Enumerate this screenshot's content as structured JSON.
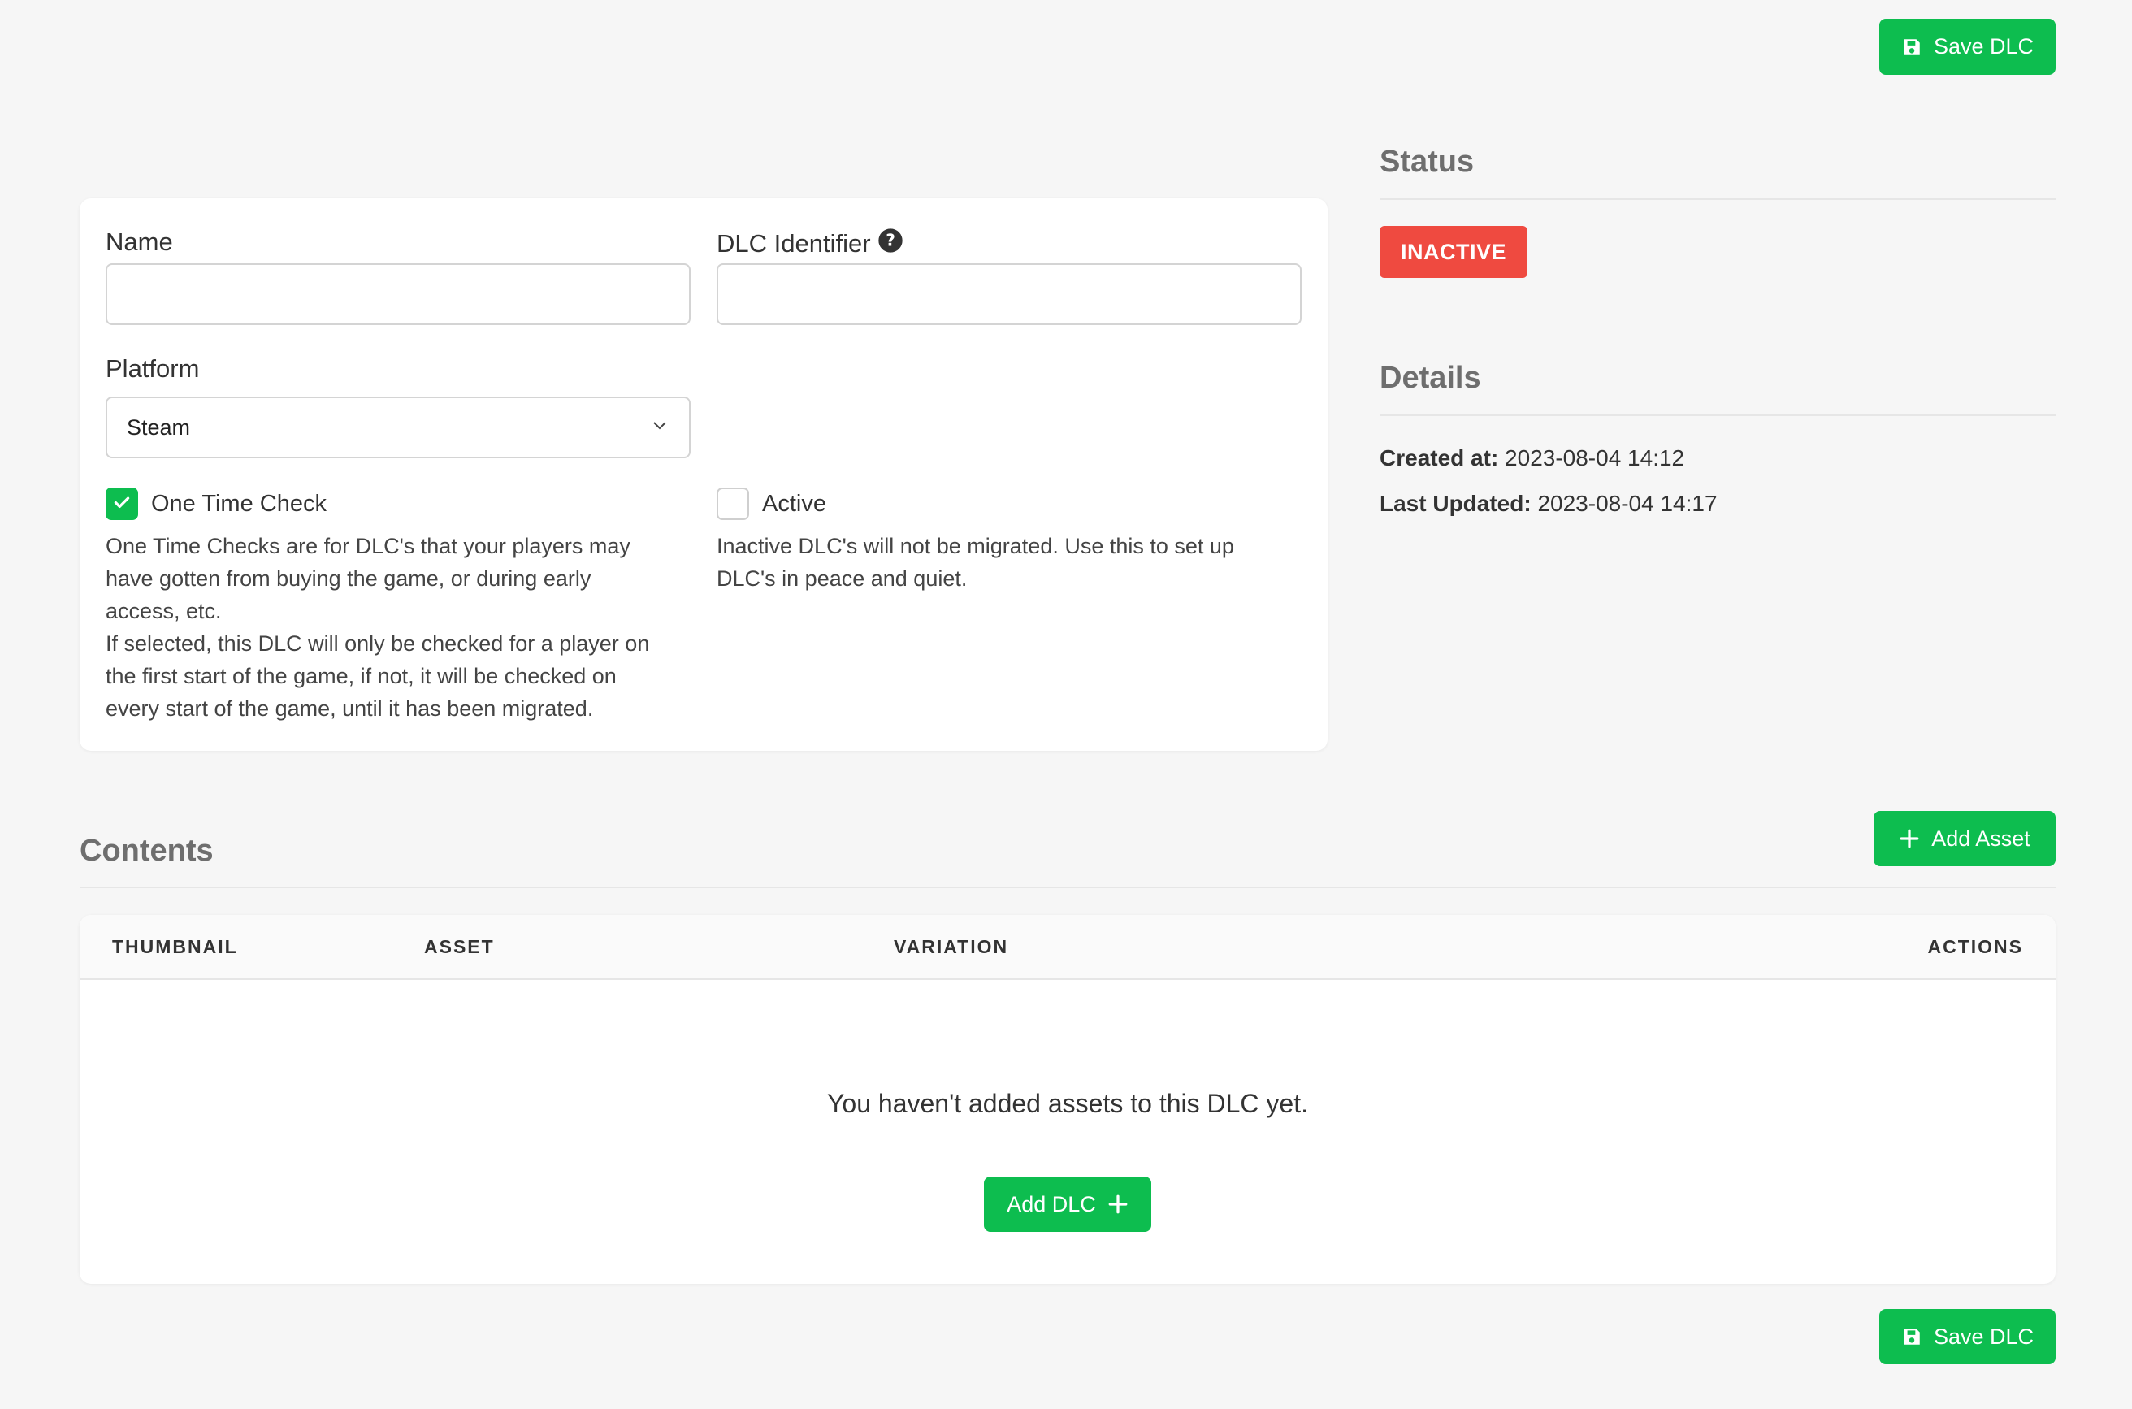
{
  "actions": {
    "save_label": "Save DLC",
    "add_asset_label": "Add Asset",
    "add_dlc_label": "Add DLC"
  },
  "form": {
    "name_label": "Name",
    "name_value": "",
    "identifier_label": "DLC Identifier",
    "identifier_value": "",
    "platform_label": "Platform",
    "platform_selected": "Steam",
    "one_time_check": {
      "label": "One Time Check",
      "checked": true,
      "help_line1": "One Time Checks are for DLC's that your players may",
      "help_line2": "have gotten from buying the game, or during early",
      "help_line3": "access, etc.",
      "help_line4": "If selected, this DLC will only be checked for a player on",
      "help_line5": "the first start of the game, if not, it will be checked on",
      "help_line6": "every start of the game, until it has been migrated."
    },
    "active": {
      "label": "Active",
      "checked": false,
      "help_line1": "Inactive DLC's will not be migrated. Use this to set up",
      "help_line2": "DLC's in peace and quiet."
    }
  },
  "status": {
    "title": "Status",
    "badge": "INACTIVE",
    "badge_color": "#ef4a40"
  },
  "details": {
    "title": "Details",
    "created_label": "Created at:",
    "created_value": "2023-08-04 14:12",
    "updated_label": "Last Updated:",
    "updated_value": "2023-08-04 14:17"
  },
  "contents": {
    "title": "Contents",
    "columns": [
      "THUMBNAIL",
      "ASSET",
      "VARIATION",
      "ACTIONS"
    ],
    "empty_message": "You haven't added assets to this DLC yet."
  },
  "colors": {
    "accent": "#0dbd4f",
    "background": "#f6f6f6"
  },
  "icons": [
    "save-icon",
    "help-circle-icon",
    "chevron-down-icon",
    "check-icon",
    "plus-icon"
  ]
}
